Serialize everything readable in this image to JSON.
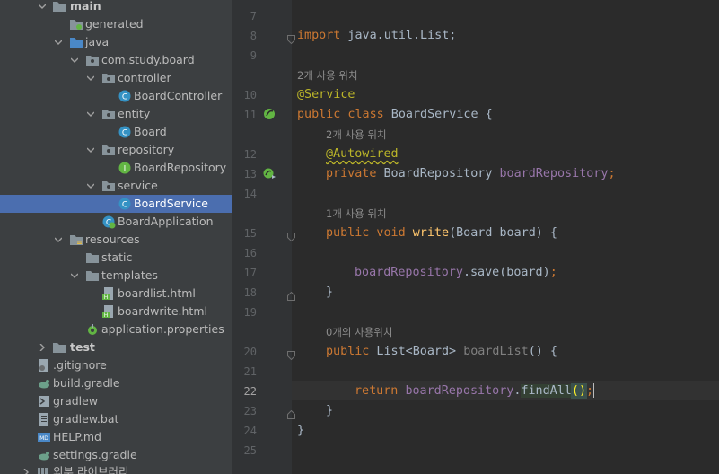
{
  "tree": {
    "items": [
      {
        "label": "main",
        "bold": true
      },
      {
        "label": "generated"
      },
      {
        "label": "java"
      },
      {
        "label": "com.study.board"
      },
      {
        "label": "controller"
      },
      {
        "label": "BoardController"
      },
      {
        "label": "entity"
      },
      {
        "label": "Board"
      },
      {
        "label": "repository"
      },
      {
        "label": "BoardRepository"
      },
      {
        "label": "service"
      },
      {
        "label": "BoardService",
        "selected": true
      },
      {
        "label": "BoardApplication"
      },
      {
        "label": "resources"
      },
      {
        "label": "static"
      },
      {
        "label": "templates"
      },
      {
        "label": "boardlist.html"
      },
      {
        "label": "boardwrite.html"
      },
      {
        "label": "application.properties"
      },
      {
        "label": "test",
        "bold": true
      },
      {
        "label": ".gitignore"
      },
      {
        "label": "build.gradle"
      },
      {
        "label": "gradlew"
      },
      {
        "label": "gradlew.bat"
      },
      {
        "label": "HELP.md"
      },
      {
        "label": "settings.gradle"
      },
      {
        "label": "외부 라이브러리"
      }
    ]
  },
  "editor": {
    "line_numbers": [
      "7",
      "8",
      "9",
      "10",
      "11",
      "12",
      "13",
      "14",
      "15",
      "16",
      "17",
      "18",
      "19",
      "20",
      "21",
      "22",
      "23",
      "24",
      "25"
    ],
    "current_line": "22",
    "hints": {
      "class_usage": "2개 사용 위치",
      "field_usage": "2개 사용 위치",
      "write_usage": "1개 사용 위치",
      "list_usage": "0개의 사용위치"
    },
    "code": {
      "l8_kw": "import",
      "l8_rest": " java.util.List;",
      "l10": "@Service",
      "l11_kw": "public class",
      "l11_rest": " BoardService {",
      "l12": "@Autowired",
      "l13_kw": "private",
      "l13_type": " BoardRepository ",
      "l13_field": "boardRepository",
      "l13_end": ";",
      "l15_kw": "public void",
      "l15_fn": " write",
      "l15_rest": "(Board board) {",
      "l17_field": "boardRepository",
      "l17_rest": ".save(board)",
      "l17_end": ";",
      "l18": "}",
      "l20_kw": "public",
      "l20_type": " List<Board> ",
      "l20_fn": "boardList",
      "l20_rest": "() {",
      "l22_kw": "return",
      "l22_sp": " ",
      "l22_field": "boardRepository",
      "l22_dot": ".",
      "l22_call": "findAll",
      "l22_open": "(",
      "l22_close": ")",
      "l22_end": ";",
      "l23": "}",
      "l24": "}"
    }
  },
  "colors": {
    "keyword": "#cc7832",
    "annotation": "#bbb529",
    "field": "#9876aa",
    "function": "#ffc66d",
    "selection": "#4b6eaf"
  }
}
